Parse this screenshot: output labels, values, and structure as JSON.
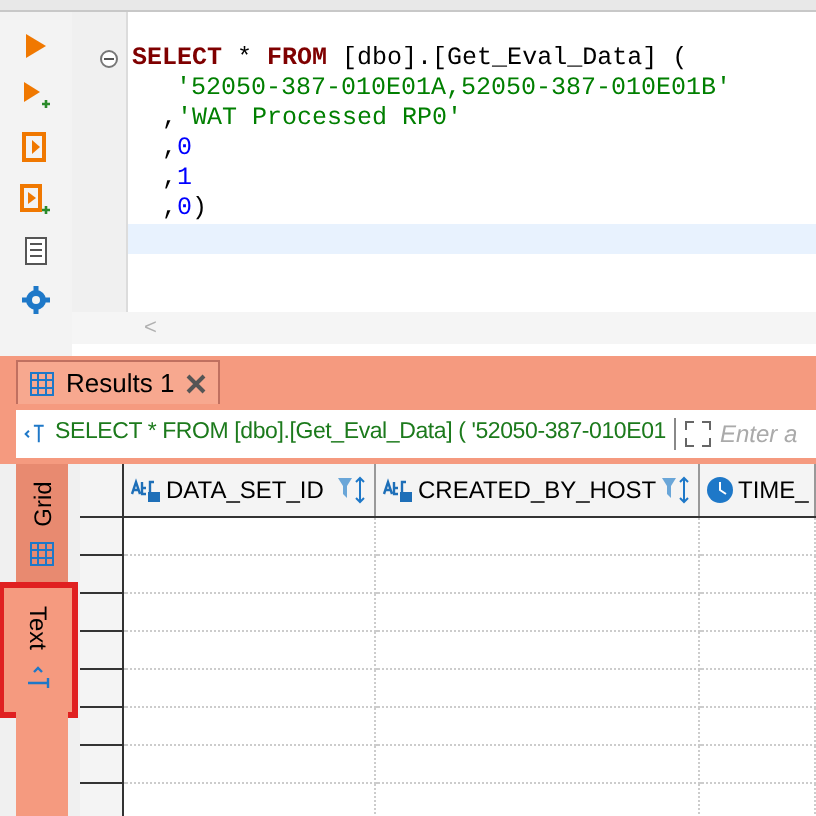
{
  "editor": {
    "lines": [
      {
        "segments": [
          {
            "text": "SELECT",
            "kind": "keyword"
          },
          {
            "text": " * ",
            "kind": "plain"
          },
          {
            "text": "FROM",
            "kind": "keyword"
          },
          {
            "text": " [dbo].[Get_Eval_Data] (",
            "kind": "plain"
          }
        ],
        "collapsible": true,
        "kind": "head"
      },
      {
        "segments": [
          {
            "text": "'52050-387-010E01A,52050-387-010E01B'",
            "kind": "string"
          }
        ],
        "collapsible": false,
        "kind": "argument"
      },
      {
        "segments": [
          {
            "text": ",",
            "kind": "plain"
          },
          {
            "text": "'WAT Processed RP0'",
            "kind": "string"
          }
        ],
        "collapsible": false,
        "kind": "continuation"
      },
      {
        "segments": [
          {
            "text": ",",
            "kind": "plain"
          },
          {
            "text": "0",
            "kind": "number"
          }
        ],
        "collapsible": false,
        "kind": "continuation"
      },
      {
        "segments": [
          {
            "text": ",",
            "kind": "plain"
          },
          {
            "text": "1",
            "kind": "number"
          }
        ],
        "collapsible": false,
        "kind": "continuation"
      },
      {
        "segments": [
          {
            "text": ",",
            "kind": "plain"
          },
          {
            "text": "0",
            "kind": "number"
          },
          {
            "text": ")",
            "kind": "plain"
          }
        ],
        "collapsible": false,
        "kind": "continuation"
      }
    ],
    "scroll_left": "<"
  },
  "results": {
    "tabs": [
      {
        "label": "Results 1",
        "selected": true
      }
    ],
    "query": "SELECT * FROM [dbo].[Get_Eval_Data] ( '52050-387-010E01",
    "filter_placeholder": "Enter a",
    "view_tabs": [
      {
        "label": "Grid",
        "selected": true,
        "highlighted": false
      },
      {
        "label": "Text",
        "selected": false,
        "highlighted": true
      }
    ],
    "columns": [
      {
        "name": "DATA_SET_ID",
        "kind": "text"
      },
      {
        "name": "CREATED_BY_HOST",
        "kind": "text"
      },
      {
        "name": "TIME_",
        "kind": "time"
      }
    ]
  }
}
